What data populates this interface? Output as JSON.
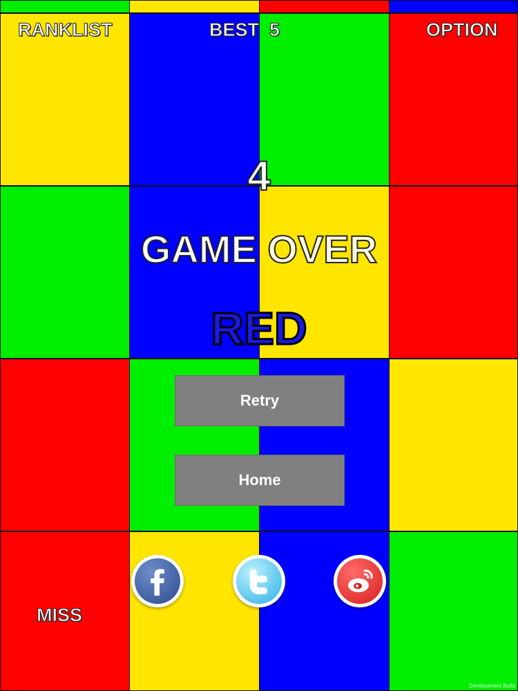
{
  "hud": {
    "ranklist_label": "RANKLIST",
    "best_label": "BEST  5",
    "option_label": "OPTION"
  },
  "game": {
    "score": "4",
    "game_over_part1": "GAME",
    "game_over_part2": "OVER",
    "color_word": "RED",
    "color_word_fill": "#1a1ae0",
    "miss_label": "MISS"
  },
  "buttons": {
    "retry_label": "Retry",
    "home_label": "Home"
  },
  "social": [
    {
      "icon": "facebook-icon"
    },
    {
      "icon": "twitter-icon"
    },
    {
      "icon": "weibo-icon"
    }
  ],
  "footer": {
    "dev_build": "Development Build"
  },
  "colors": {
    "yellow": "#ffe600",
    "blue": "#0000ff",
    "green": "#00ee00",
    "red": "#ff0000",
    "button_gray": "#808080"
  },
  "grid": {
    "top_strip": [
      "green",
      "yellow",
      "red",
      "blue"
    ],
    "rows": [
      [
        "yellow",
        "blue",
        "green",
        "red"
      ],
      [
        "green",
        "blue",
        "yellow",
        "red"
      ],
      [
        "red",
        "green",
        "blue",
        "yellow"
      ],
      [
        "red",
        "yellow",
        "blue",
        "green"
      ]
    ]
  }
}
